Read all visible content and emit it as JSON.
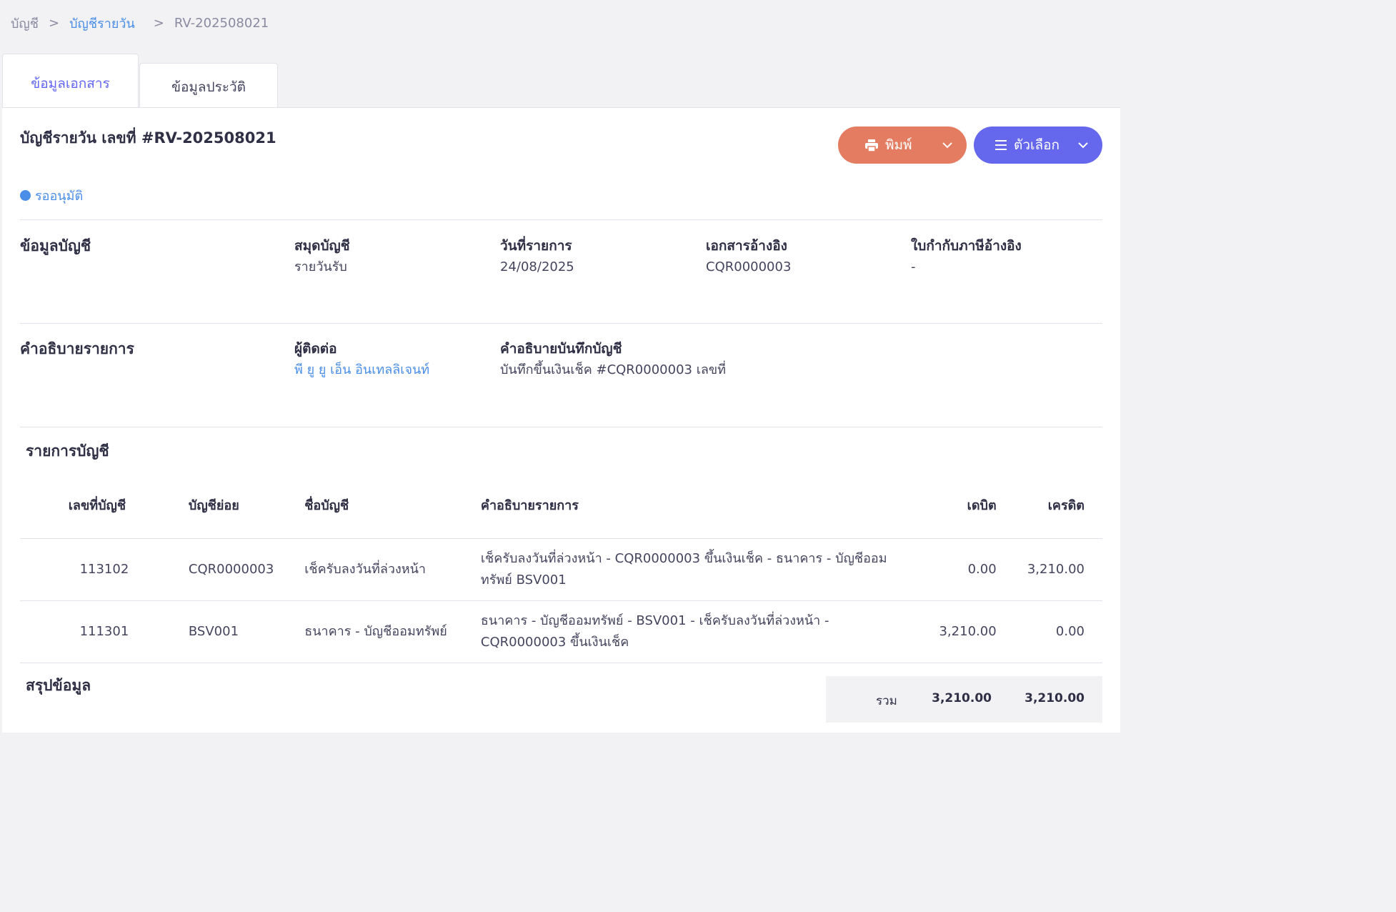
{
  "breadcrumb": [
    "บัญชี",
    "บัญชีรายวัน",
    "RV-202508021"
  ],
  "tabs": [
    {
      "label": "ข้อมูลเอกสาร",
      "active": true
    },
    {
      "label": "ข้อมูลประวัติ",
      "active": false
    }
  ],
  "document": {
    "title": "บัญชีรายวัน เลขที่ #RV-202508021",
    "status": "รออนุมัติ"
  },
  "actions": {
    "print_label": "พิมพ์",
    "options_label": "ตัวเลือก"
  },
  "account_info": {
    "section_title": "ข้อมูลบัญชี",
    "fields": [
      {
        "label": "สมุดบัญชี",
        "value": "รายวันรับ"
      },
      {
        "label": "วันที่รายการ",
        "value": "24/08/2025"
      },
      {
        "label": "เอกสารอ้างอิง",
        "value": "CQR0000003"
      },
      {
        "label": "ใบกำกับภาษีอ้างอิง",
        "value": "-"
      }
    ]
  },
  "description": {
    "section_title": "คำอธิบายรายการ",
    "contact_label": "ผู้ติดต่อ",
    "contact_value": "พี ยู ยู เอ็น อินเทลลิเจนท์",
    "note_label": "คำอธิบายบันทึกบัญชี",
    "note_value": "บันทึกขึ้นเงินเช็ค #CQR0000003 เลขที่"
  },
  "entries": {
    "section_title": "รายการบัญชี",
    "headers": [
      "เลขที่บัญชี",
      "บัญชีย่อย",
      "ชื่อบัญชี",
      "คำอธิบายรายการ",
      "เดบิต",
      "เครดิต"
    ],
    "rows": [
      [
        "113102",
        "CQR0000003",
        "เช็ครับลงวันที่ล่วงหน้า",
        "เช็ครับลงวันที่ล่วงหน้า - CQR0000003 ขึ้นเงินเช็ค - ธนาคาร - บัญชีออมทรัพย์ BSV001",
        "0.00",
        "3,210.00"
      ],
      [
        "111301",
        "BSV001",
        "ธนาคาร - บัญชีออมทรัพย์",
        "ธนาคาร - บัญชีออมทรัพย์ - BSV001 - เช็ครับลงวันที่ล่วงหน้า - CQR0000003 ขึ้นเงินเช็ค",
        "3,210.00",
        "0.00"
      ]
    ]
  },
  "summary": {
    "section_title": "สรุปข้อมูล",
    "total_label": "รวม",
    "total_debit": "3,210.00",
    "total_credit": "3,210.00"
  },
  "colors": {
    "accent": "#6366f1",
    "print_button": "#e47c61",
    "options_button": "#6567ec",
    "link": "#4a8ee8"
  },
  "icons": [
    "printer-icon",
    "menu-icon",
    "chevron-down-icon"
  ]
}
